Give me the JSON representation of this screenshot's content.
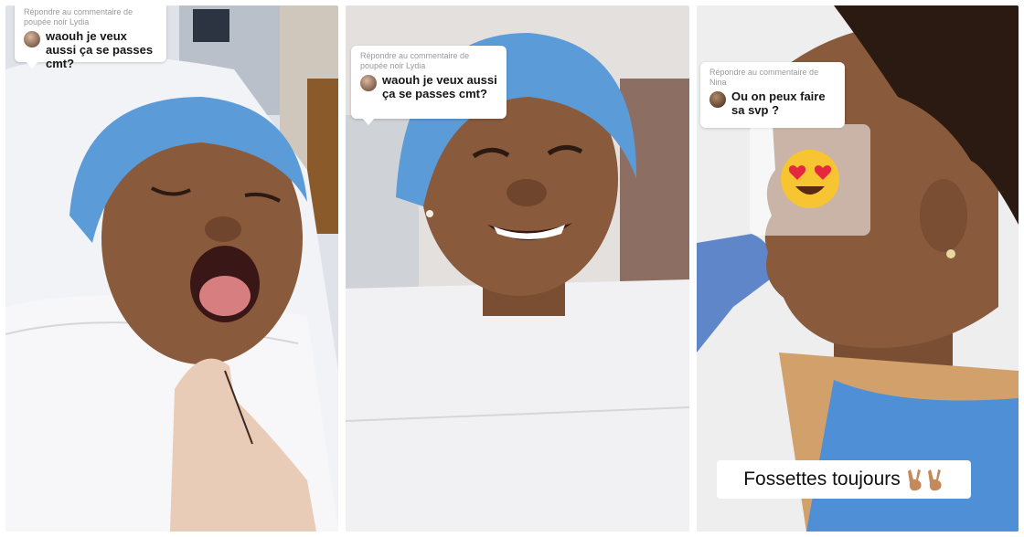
{
  "panels": [
    {
      "comment": {
        "reply_meta": "Répondre au commentaire de poupée noir Lydia",
        "text": "waouh je veux aussi ça se passes cmt?"
      }
    },
    {
      "comment": {
        "reply_meta": "Répondre au commentaire de poupée noir Lydia",
        "text": "waouh je veux aussi ça se passes cmt?"
      }
    },
    {
      "comment": {
        "reply_meta": "Répondre au commentaire de Nina",
        "text": "Ou on peux faire sa svp ?"
      },
      "emoji_sticker": "heart-eyes-emoji",
      "caption": "Fossettes toujours"
    }
  ],
  "colors": {
    "surgical_cap": "#5b9bd8",
    "scrubs": "#4f8fd6",
    "glove": "#5f86c9",
    "skin": "#8a5a3c",
    "bib": "#f1f0f2"
  },
  "icons": {
    "caption_emoji": "victory-hand-emoji"
  }
}
